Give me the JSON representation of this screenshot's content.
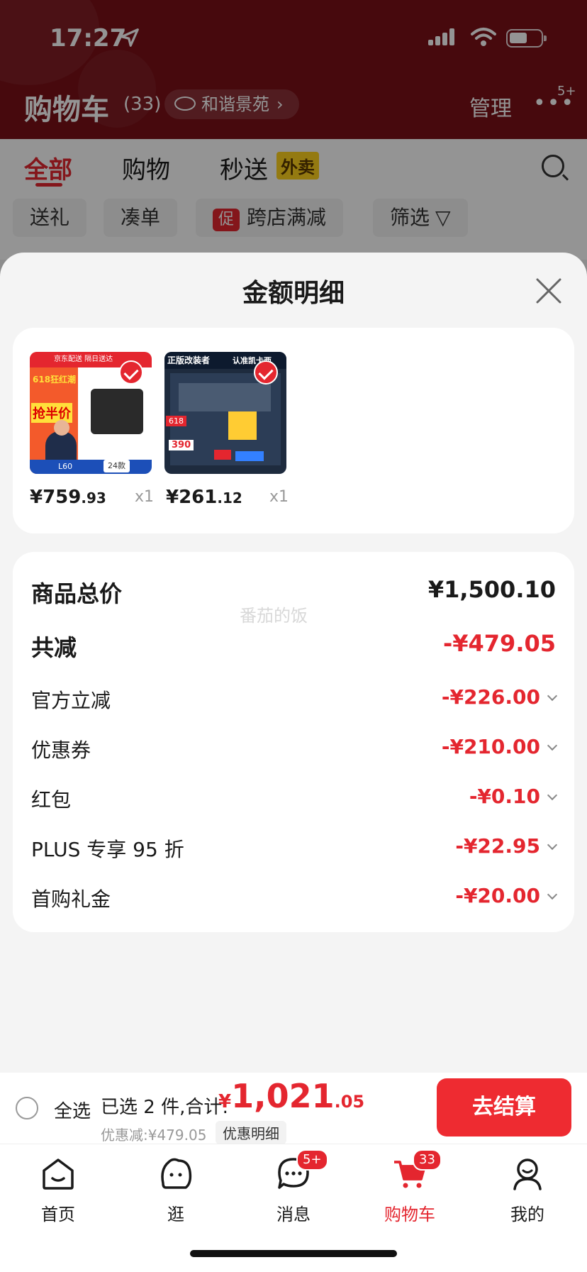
{
  "status": {
    "time": "17:27"
  },
  "header": {
    "title": "购物车",
    "count": "(33)",
    "address": "和谐景苑",
    "manage": "管理",
    "more": "•••",
    "more_badge": "5+"
  },
  "tabs": [
    {
      "label": "全部",
      "active": true
    },
    {
      "label": "购物"
    },
    {
      "label": "秒送"
    }
  ],
  "tab_badge": "外卖",
  "chips": [
    {
      "label": "送礼"
    },
    {
      "label": "凑单"
    },
    {
      "label": "跨店满减",
      "tag": "促"
    },
    {
      "label": "筛选"
    }
  ],
  "sheet": {
    "title": "金额明细",
    "products": [
      {
        "price_int": "¥759",
        "price_dec": ".93",
        "qty": "x1",
        "img_text": [
          "京东配送 隔日送达",
          "618狂红潮",
          "抢半价",
          "L60",
          "24款"
        ]
      },
      {
        "price_int": "¥261",
        "price_dec": ".12",
        "qty": "x1",
        "img_text": [
          "正版改装者",
          "认准凯卡西",
          "618",
          "390"
        ]
      }
    ],
    "watermark": "番茄的饭",
    "rows": [
      {
        "label": "商品总价",
        "value": "¥1,500.10",
        "big": true,
        "black": true
      },
      {
        "label": "共减",
        "value": "-¥479.05",
        "big": true
      },
      {
        "label": "官方立减",
        "value": "-¥226.00"
      },
      {
        "label": "优惠券",
        "value": "-¥210.00"
      },
      {
        "label": "红包",
        "value": "-¥0.10"
      },
      {
        "label": "PLUS 专享 95 折",
        "value": "-¥22.95"
      },
      {
        "label": "首购礼金",
        "value": "-¥20.00"
      }
    ]
  },
  "checkout": {
    "select_all": "全选",
    "selected_text": "已选 2 件,合计:",
    "total_yen": "¥",
    "total_int": "1,021",
    "total_dec": ".05",
    "discount": "优惠减:¥479.05",
    "detail_button": "优惠明细",
    "pay_button": "去结算"
  },
  "tabbar": [
    {
      "label": "首页",
      "icon": "home-icon"
    },
    {
      "label": "逛",
      "icon": "mascot-icon"
    },
    {
      "label": "消息",
      "icon": "message-icon",
      "badge": "5+"
    },
    {
      "label": "购物车",
      "icon": "cart-icon",
      "badge": "33",
      "active": true
    },
    {
      "label": "我的",
      "icon": "profile-icon"
    }
  ],
  "colors": {
    "accent": "#e4262f",
    "header": "#7a1018"
  }
}
